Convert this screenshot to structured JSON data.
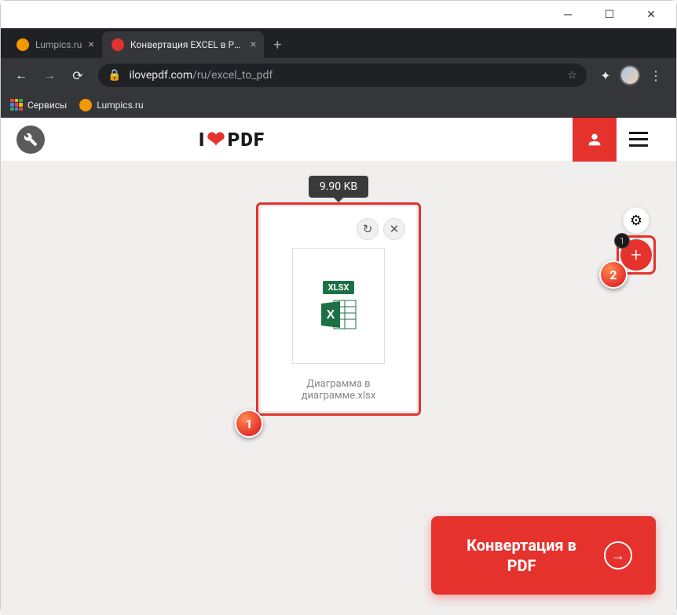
{
  "window": {
    "tabs": [
      {
        "title": "Lumpics.ru",
        "active": false
      },
      {
        "title": "Конвертация EXCEL в PDF. Доку",
        "active": true
      }
    ]
  },
  "address": {
    "domain": "ilovepdf.com",
    "path": "/ru/excel_to_pdf"
  },
  "bookmarks": {
    "apps": "Сервисы",
    "item1": "Lumpics.ru"
  },
  "logo": {
    "prefix": "I",
    "suffix": "PDF"
  },
  "file": {
    "size": "9.90 KB",
    "badge": "XLSX",
    "name": "Диаграмма в диаграмме.xlsx"
  },
  "add_badge": "1",
  "callouts": {
    "one": "1",
    "two": "2"
  },
  "convert": "Конвертация в PDF"
}
